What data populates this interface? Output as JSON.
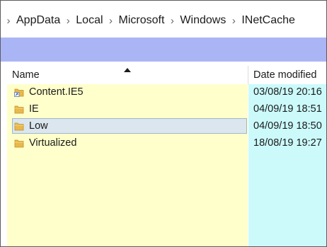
{
  "breadcrumb": {
    "items": [
      "AppData",
      "Local",
      "Microsoft",
      "Windows",
      "INetCache"
    ],
    "separator": "›"
  },
  "columns": {
    "name": "Name",
    "date_modified": "Date modified"
  },
  "rows": [
    {
      "name": "Content.IE5",
      "date": "03/08/19 20:16",
      "icon": "folder-shortcut-icon"
    },
    {
      "name": "IE",
      "date": "04/09/19 18:51",
      "icon": "folder-icon"
    },
    {
      "name": "Low",
      "date": "04/09/19 18:50",
      "icon": "folder-icon",
      "selected": true
    },
    {
      "name": "Virtualized",
      "date": "18/08/19 19:27",
      "icon": "folder-icon"
    }
  ],
  "colors": {
    "address_bar": "#aab5f6",
    "name_column_bg": "#ffffcb",
    "date_column_bg": "#ccfafb",
    "selection_bg": "#dbe6ef",
    "folder_yellow": "#e8b94a"
  }
}
